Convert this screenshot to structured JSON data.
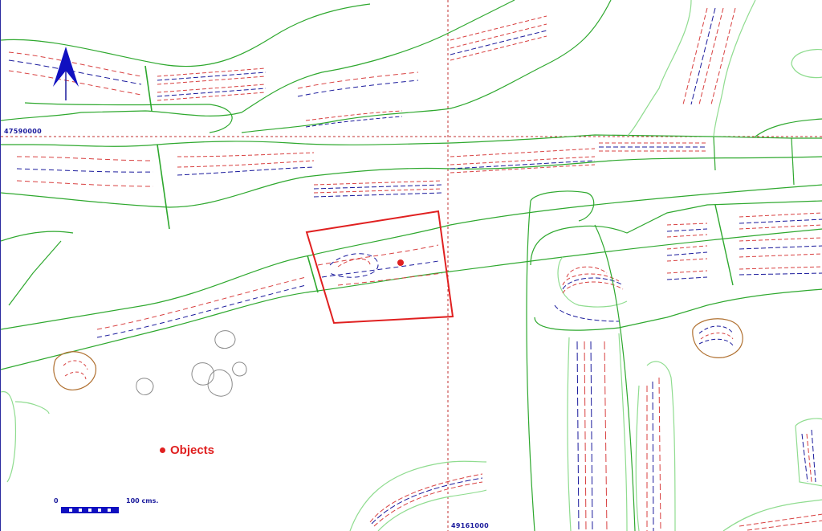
{
  "map": {
    "coord_y_label": "47590000",
    "coord_x_label": "49161000",
    "legend_label": "Objects",
    "scale_start": "0",
    "scale_end": "100 cms.",
    "north_arrow_icon": "north-arrow-icon",
    "colors": {
      "outline": "#2ea82e",
      "light_outline": "#8fdc8f",
      "contour_red": "#d84040",
      "contour_blue": "#1a1a9c",
      "selection": "#e02020",
      "grid": "#c03030",
      "stone": "#b07030"
    }
  }
}
